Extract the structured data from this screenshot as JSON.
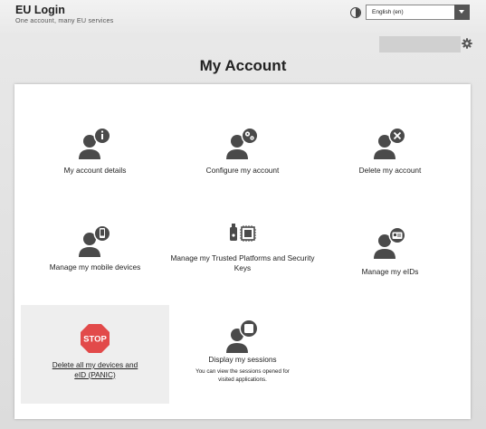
{
  "header": {
    "title": "EU Login",
    "subtitle": "One account, many EU services",
    "language_selected": "English (en)"
  },
  "icons": {
    "contrast": "contrast-icon",
    "language_dropdown": "chevron-down-icon",
    "settings": "gear-icon"
  },
  "page": {
    "title": "My Account"
  },
  "tiles": [
    {
      "label": "My account details",
      "icon": "user-info-icon"
    },
    {
      "label": "Configure my account",
      "icon": "user-gear-icon"
    },
    {
      "label": "Delete my account",
      "icon": "user-delete-icon"
    },
    {
      "label": "Manage my mobile devices",
      "icon": "user-mobile-icon"
    },
    {
      "label": "Manage my Trusted Platforms and Security Keys",
      "icon": "security-key-chip-icon"
    },
    {
      "label": "Manage my eIDs",
      "icon": "user-eid-card-icon"
    },
    {
      "label": "Delete all my devices and eID (PANIC)",
      "icon": "stop-sign-icon",
      "icon_text": "STOP"
    },
    {
      "label": "Display my sessions",
      "icon": "user-sessions-icon",
      "note": "You can view the sessions opened for visited applications."
    }
  ],
  "colors": {
    "stop_red": "#e24a4a",
    "icon_gray": "#4a4a4a",
    "panic_bg": "#eeeeee"
  }
}
